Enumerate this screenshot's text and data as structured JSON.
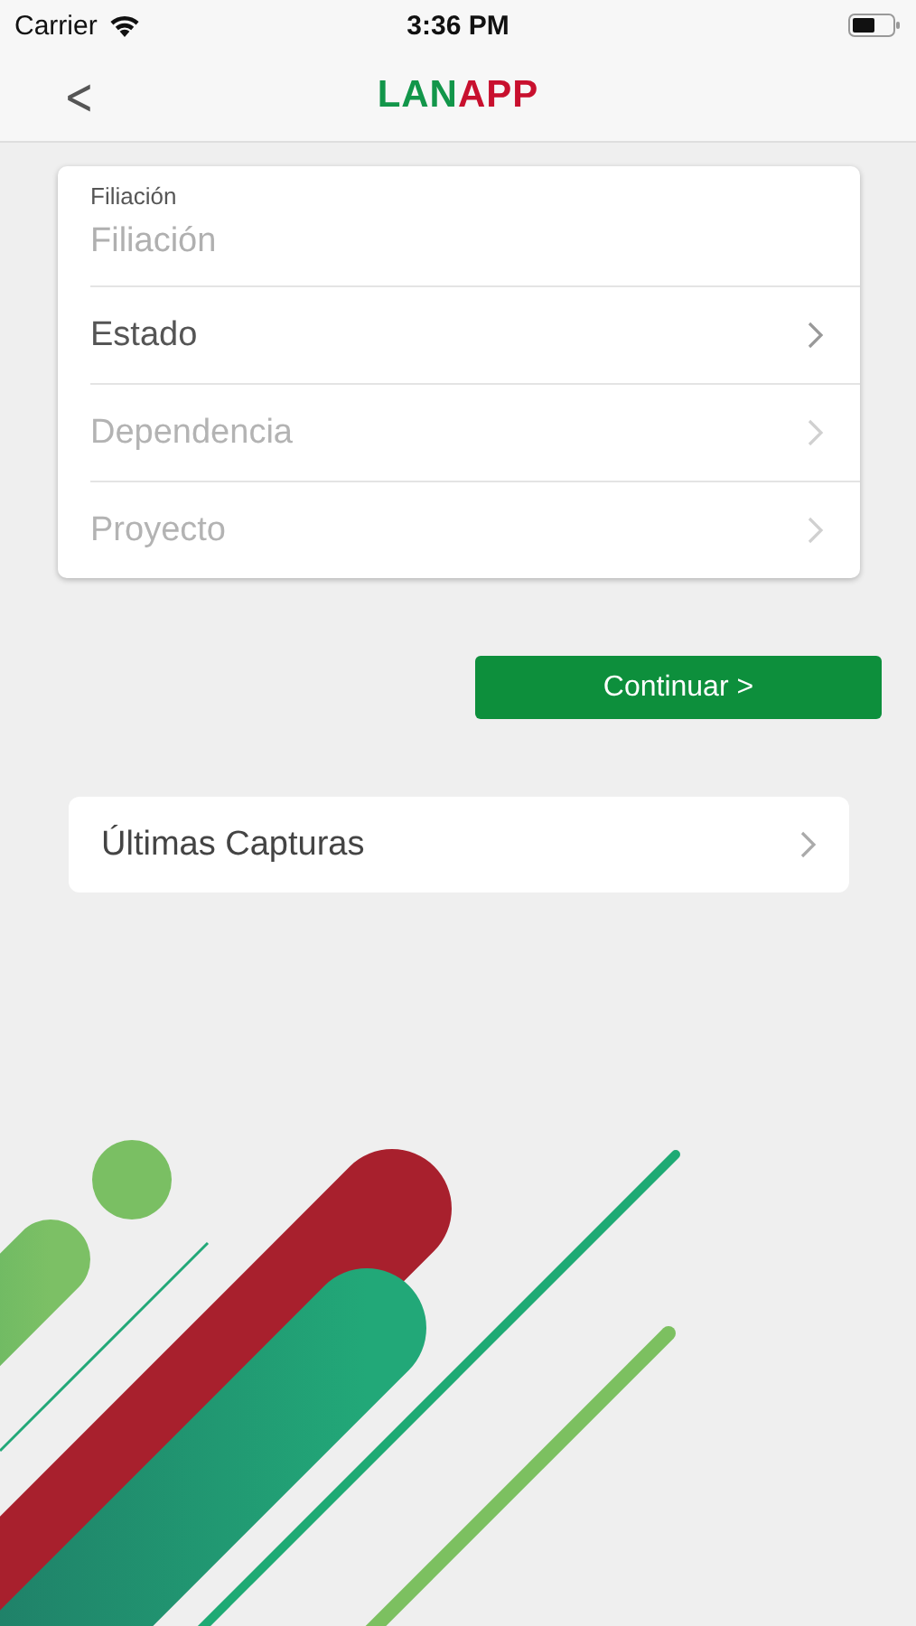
{
  "status_bar": {
    "carrier": "Carrier",
    "time": "3:36 PM"
  },
  "nav": {
    "back": "<",
    "logo": [
      {
        "text": "LAN",
        "color": "#12964a"
      },
      {
        "text": "APP",
        "color": "#c8102e"
      }
    ]
  },
  "form": {
    "field": {
      "label": "Filiación",
      "placeholder": "Filiación"
    },
    "selects": [
      {
        "label": "Estado",
        "disabled": false
      },
      {
        "label": "Dependencia",
        "disabled": true
      },
      {
        "label": "Proyecto",
        "disabled": true
      }
    ]
  },
  "continue_button": "Continuar >",
  "recent": {
    "label": "Últimas Capturas"
  }
}
